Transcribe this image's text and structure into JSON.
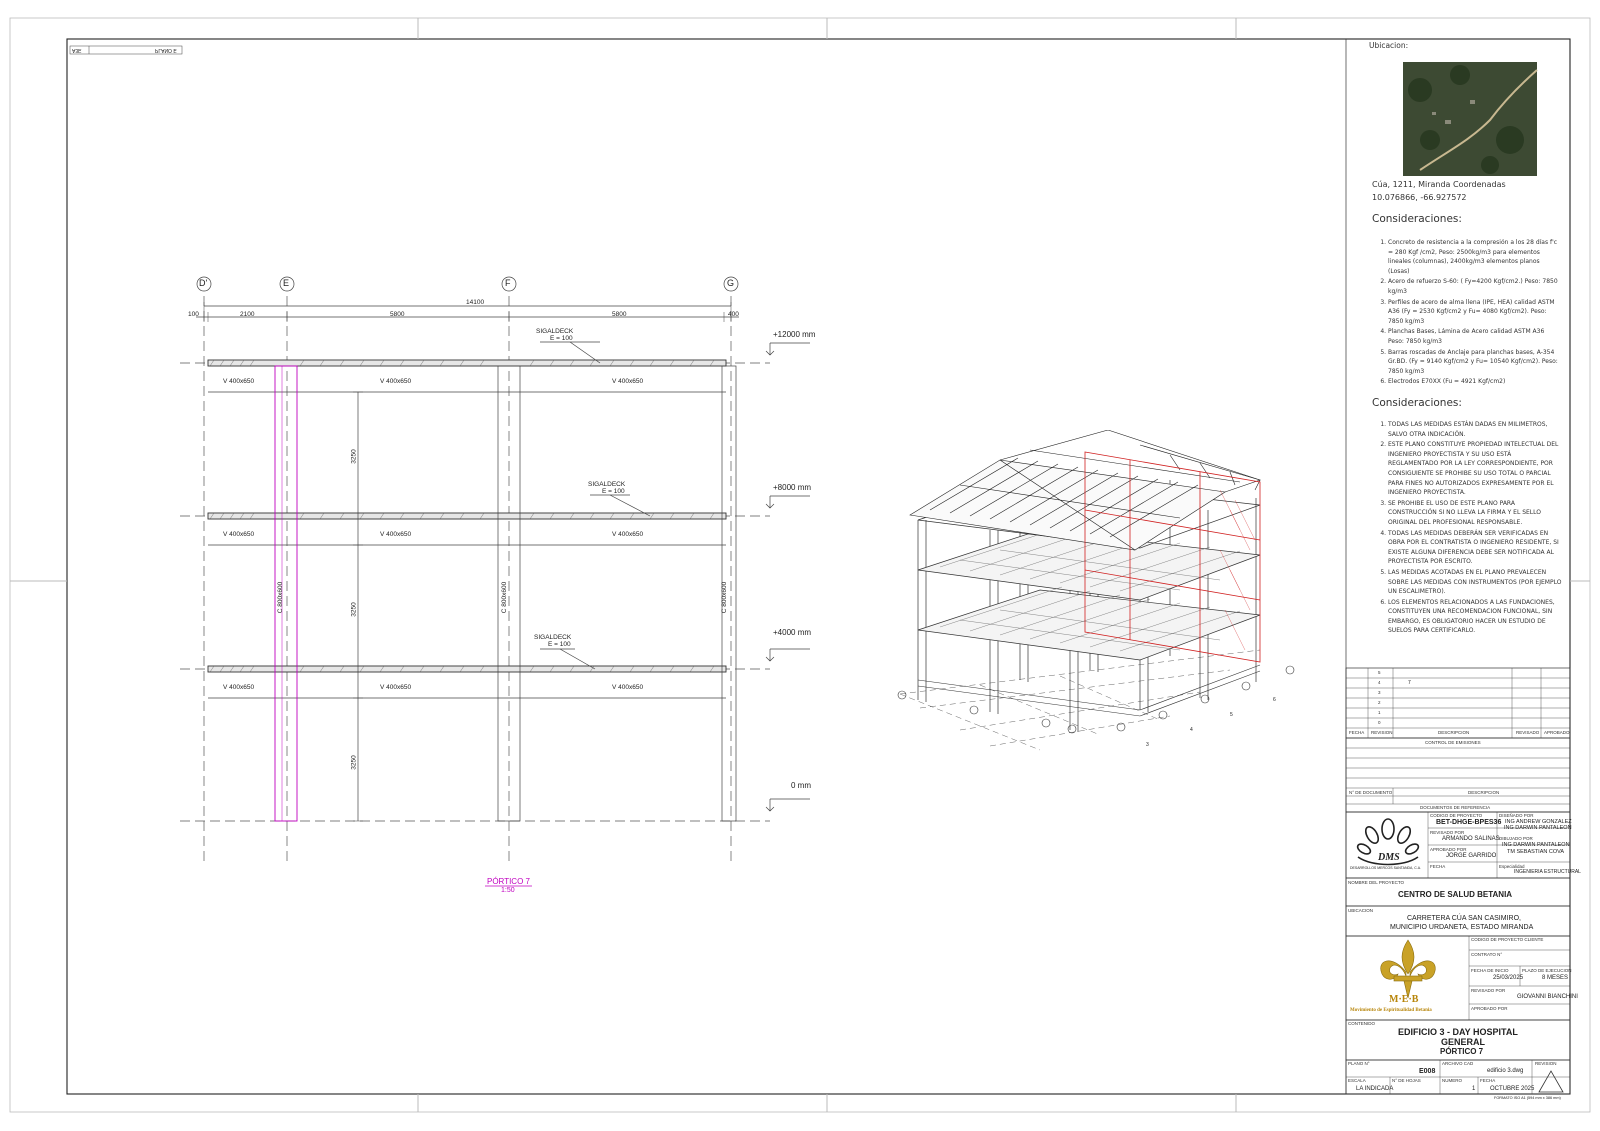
{
  "drawing": {
    "view_title": "PÓRTICO 7",
    "view_scale": "1:50",
    "corner_tag_left": "A3E",
    "corner_tag_right": "PLANO E",
    "axes": [
      "D'",
      "E",
      "F",
      "G"
    ],
    "dims_top": {
      "total": "14100",
      "edge_left": "100",
      "span1": "2100",
      "span2": "5800",
      "span3": "5800",
      "edge_right": "400"
    },
    "levels": [
      "+12000 mm",
      "+8000 mm",
      "+4000 mm",
      "0 mm"
    ],
    "heights": [
      "3250",
      "3250",
      "3250"
    ],
    "slab_labels": [
      {
        "name": "SIGALDECK",
        "thk": "E = 100"
      },
      {
        "name": "SIGALDECK",
        "thk": "E = 100"
      },
      {
        "name": "SIGALDECK",
        "thk": "E = 100"
      }
    ],
    "beam_label": "V 400x650",
    "column_labels": [
      "C 800x600",
      "C 800x600",
      "C 800x600"
    ],
    "iso_axes": [
      "7",
      "6",
      "5",
      "4",
      "3",
      "2",
      "1"
    ]
  },
  "title_block": {
    "location_heading": "Ubicacion:",
    "location_text_1": "Cúa, 1211, Miranda Coordenadas",
    "location_text_2": "10.076866, -66.927572",
    "considerations_heading_1": "Consideraciones:",
    "materials": [
      "Concreto de resistencia a la compresión a los 28 días f'c = 280 Kgf /cm2, Peso: 2500kg/m3 para elementos lineales (columnas), 2400kg/m3 elementos planos (Losas)",
      "Acero de refuerzo S-60: ( Fy=4200 Kgf/cm2.) Peso: 7850 kg/m3",
      "Perfiles de acero de alma llena (IPE, HEA) calidad ASTM A36 (Fy = 2530 Kgf/cm2 y Fu= 4080 Kgf/cm2). Peso: 7850 kg/m3",
      "Planchas Bases, Lámina de Acero calidad ASTM A36 Peso: 7850 kg/m3",
      "Barras roscadas de Anclaje para planchas bases, A-354 Gr.BD. (Fy = 9140 Kgf/cm2 y Fu= 10540 Kgf/cm2). Peso: 7850 kg/m3",
      "Electrodos E70XX (Fu = 4921 Kgf/cm2)"
    ],
    "considerations_heading_2": "Consideraciones:",
    "general_notes": [
      "TODAS LAS MEDIDAS ESTÁN DADAS EN MILIMETROS, SALVO OTRA INDICACIÓN.",
      "ESTE PLANO CONSTITUYE PROPIEDAD INTELECTUAL DEL INGENIERO PROYECTISTA Y SU USO ESTÁ REGLAMENTADO POR LA LEY CORRESPONDIENTE, POR CONSIGUIENTE SE PROHIBE SU USO TOTAL O PARCIAL PARA FINES NO AUTORIZADOS EXPRESAMENTE POR EL INGENIERO PROYECTISTA.",
      "SE PROHIBE EL USO DE ESTE PLANO PARA CONSTRUCCIÓN SI NO LLEVA LA FIRMA Y EL SELLO ORIGINAL DEL PROFESIONAL RESPONSABLE.",
      "TODAS LAS MEDIDAS DEBERÁN SER VERIFICADAS EN OBRA POR EL CONTRATISTA O INGENIERO RESIDENTE, SI EXISTE ALGUNA DIFERENCIA DEBE SER NOTIFICADA AL PROYECTISTA POR ESCRITO.",
      "LAS MEDIDAS ACOTADAS EN EL PLANO PREVALECEN SOBRE LAS MEDIDAS CON INSTRUMENTOS (POR EJEMPLO UN ESCALIMETRO).",
      "LOS ELEMENTOS RELACIONADOS A LAS FUNDACIONES, CONSTITUYEN UNA RECOMENDACION FUNCIONAL, SIN EMBARGO, ES OBLIGATORIO HACER UN ESTUDIO DE SUELOS PARA CERTIFICARLO."
    ],
    "revisions_rows": [
      "5",
      "4",
      "3",
      "2",
      "1",
      "0"
    ],
    "rev_headers": {
      "fecha": "FECHA",
      "revision": "REVISION",
      "descripcion": "DESCRIPCION",
      "revisado": "REVISADO",
      "aprobado": "APROBADO"
    },
    "control_emisiones": "CONTROL DE EMISIONES",
    "ref_headers": {
      "doc": "N° DE DOCUMENTO",
      "desc": "DESCRIPCION"
    },
    "documentos_referencia": "DOCUMENTOS DE REFERENCIA",
    "codigo_proyecto_lbl": "CODIGO DE PROYECTO",
    "codigo_proyecto": "BET-DHGE-BPES36",
    "revisado_por_lbl": "REVISADO POR",
    "revisado_por": "ARMANDO SALINAS",
    "aprobado_por_lbl": "APROBADO POR",
    "aprobado_por": "JORGE GARRIDO",
    "fecha_lbl": "FECHA",
    "disenado_por_lbl": "DISEÑADO POR",
    "disenado_por_1": "ING ANDREW GONZALEZ",
    "disenado_por_2": "ING DARWIN PANTALEON",
    "dibujado_por_lbl": "DIBUJADO POR",
    "dibujado_por_1": "ING DARWIN PANTALEON",
    "dibujado_por_2": "TM SEBASTIAN COVA",
    "especialidad_lbl": "Especialidad",
    "especialidad": "INGENIERIA ESTRUCTURAL",
    "dms_logo": "DMS",
    "dms_sub": "DESARROLLOS MERCOS SANTANDA, C.A.",
    "nombre_proyecto_lbl": "NOMBRE DEL PROYECTO",
    "nombre_proyecto": "CENTRO DE SALUD BETANIA",
    "ubicacion_lbl": "UBICACION",
    "ubicacion_1": "CARRETERA CÚA SAN CASIMIRO,",
    "ubicacion_2": "MUNICIPIO URDANETA, ESTADO MIRANDA",
    "codigo_cliente_lbl": "CODIGO DE PROYECTO CLIENTE",
    "contrato_lbl": "CONTRATO N°",
    "fecha_inicio_lbl": "FECHA DE INICIO",
    "fecha_inicio": "25/03/2025",
    "plazo_lbl": "PLAZO DE EJECUCION",
    "plazo": "8 MESES",
    "revisado_por2_lbl": "REVISADO POR",
    "revisado_por2": "GIOVANNI BIANCHINI",
    "aprobado_por2_lbl": "APROBADO POR",
    "meb_logo": "M·E·B",
    "meb_sub": "Movimiento de Espiritualidad Betania",
    "contenido_lbl": "CONTENIDO",
    "contenido_1": "EDIFICIO 3 - DAY HOSPITAL",
    "contenido_2": "GENERAL",
    "contenido_3": "PÓRTICO 7",
    "plano_lbl": "PLANO N°",
    "plano": "E008",
    "archivo_lbl": "ARCHIVO CAD",
    "archivo": "edificio 3.dwg",
    "revision_lbl": "REVISION",
    "escala_lbl": "ESCALA",
    "escala": "LA INDICADA",
    "hojas_lbl": "N° DE HOJAS",
    "numero_lbl": "NUMERO",
    "numero": "1",
    "fecha2_lbl": "FECHA",
    "fecha2": "OCTUBRE 2025",
    "formato": "FORMATO ISO A1 (594 mm x 386 mm)"
  },
  "colors": {
    "line": "#333333",
    "magenta": "#c000c0",
    "red": "#d02020"
  }
}
